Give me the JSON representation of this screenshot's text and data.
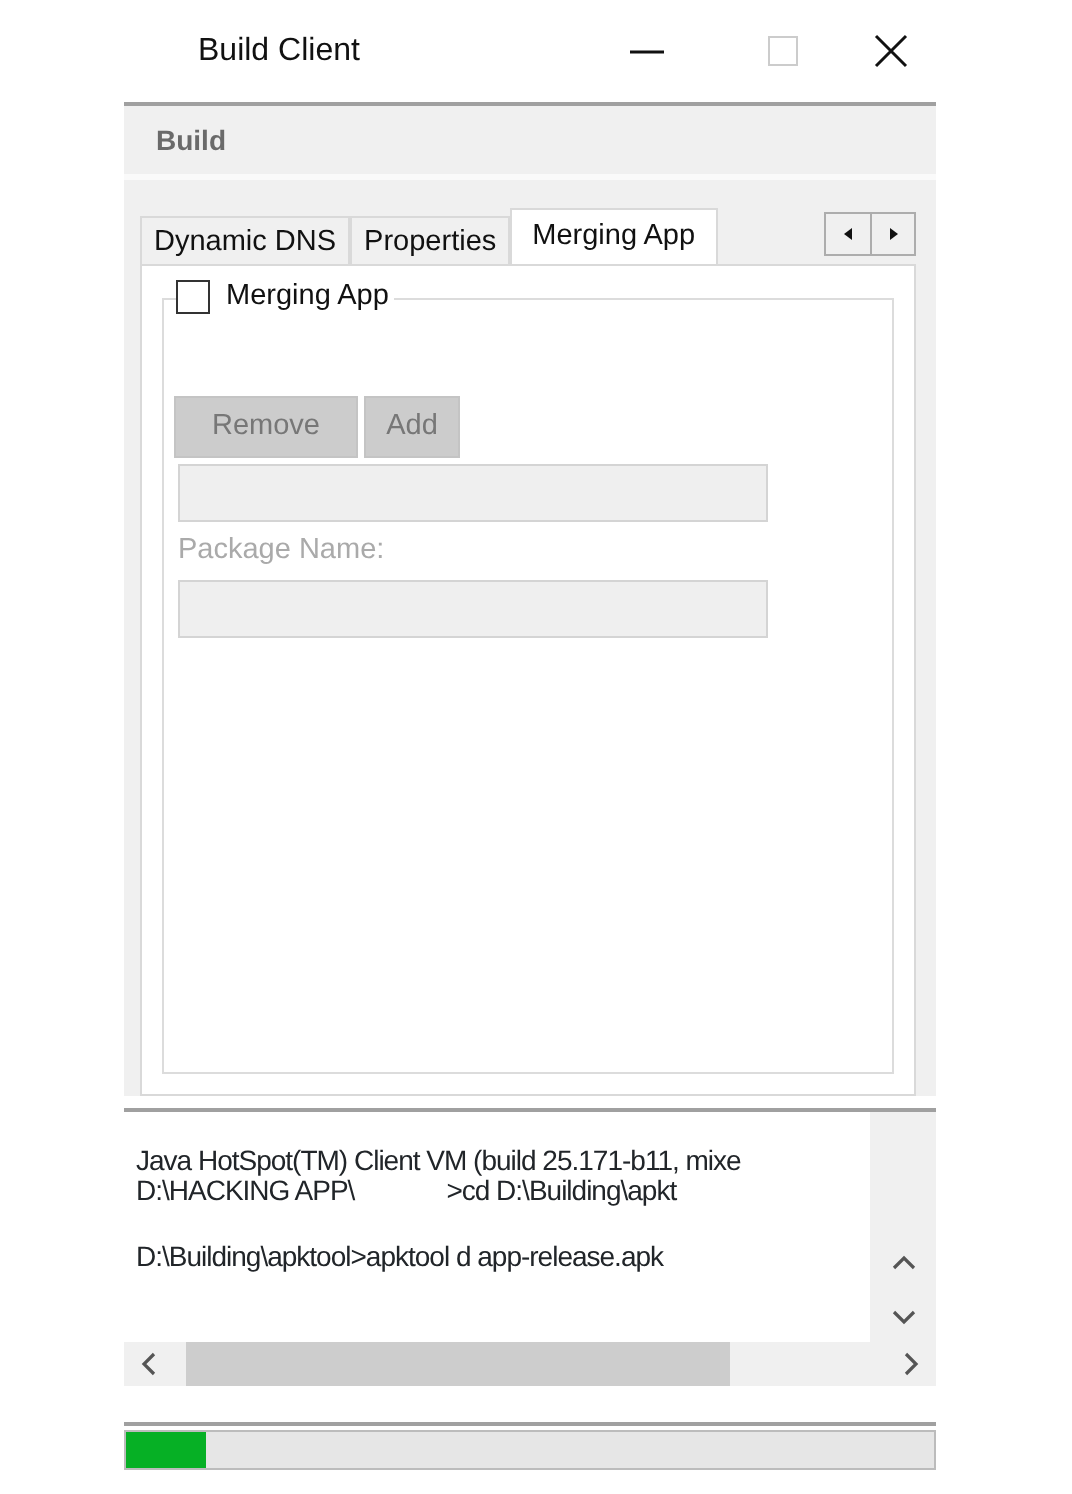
{
  "window": {
    "title": "Build Client"
  },
  "menu": {
    "label": "Build"
  },
  "tabs": [
    {
      "label": "Dynamic DNS",
      "selected": false
    },
    {
      "label": "Properties",
      "selected": false
    },
    {
      "label": "Merging App",
      "selected": true
    }
  ],
  "group": {
    "label": "Merging App",
    "checked": false,
    "disabled": true,
    "buttons": [
      "Remove",
      "Add"
    ],
    "package_label": "Package Name:"
  },
  "console": {
    "lines": [
      {
        "parts": [
          "Java HotSpot(TM) Client VM (build 25.171-b11, mixe"
        ],
        "blank_before": false
      },
      {
        "parts": [
          "D:\\HACKING APP\\",
          ">cd D:\\Building\\apkt"
        ],
        "blank_before": false
      },
      {
        "parts": [
          "D:\\Building\\apktool>apktool d app-release.apk"
        ],
        "blank_before": true
      }
    ]
  },
  "progress": {
    "level": 0.1
  }
}
